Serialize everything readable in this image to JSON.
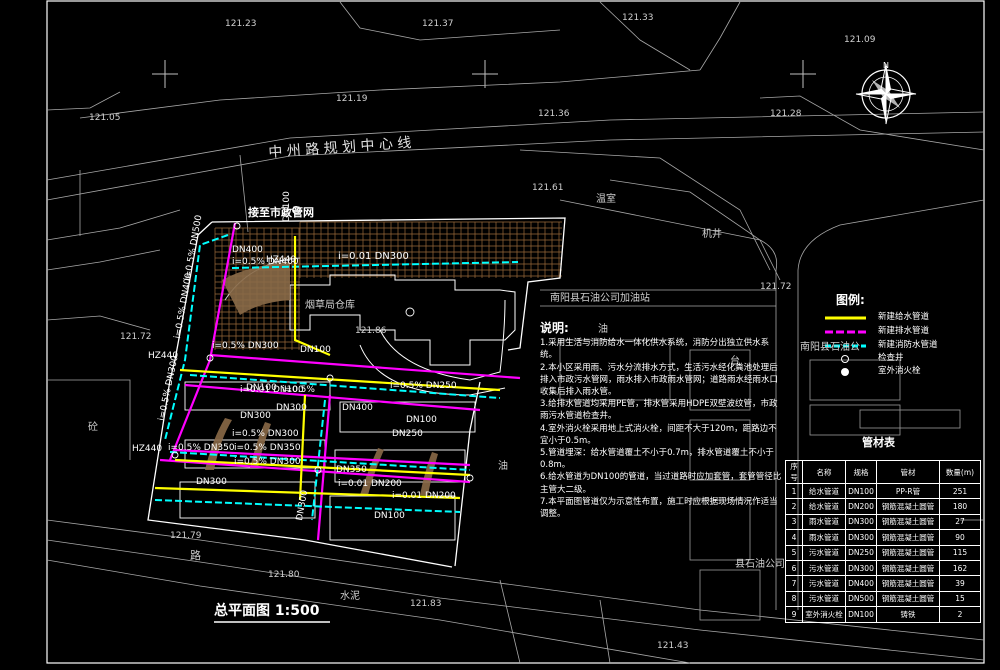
{
  "drawing_title": "总平面图  1:500",
  "road_centerline_label": "中 州 路 规 划 中 心 线",
  "connect_label": "接至市政管网",
  "site_labels": {
    "warehouse": "烟草局仓库",
    "gas_station": "南阳县石油公司加油站",
    "oil_company_right": "南阳县石油公",
    "oil_company_bottom": "县石油公司",
    "well": "机井",
    "road": "路",
    "ditch": "水泥",
    "hill": "砼",
    "oil": "油",
    "shed": "棚",
    "shed2": "温室",
    "gate": "台"
  },
  "elevations": [
    "121.23",
    "121.37",
    "121.33",
    "121.09",
    "121.19",
    "121.36",
    "121.05",
    "121.28",
    "121.61",
    "121.72",
    "121.72",
    "121.80",
    "121.83",
    "121.79",
    "121.43",
    "121.86"
  ],
  "pipes": {
    "main_dn300": "i=0.01 DN300",
    "dn400": "DN400",
    "slope_dn400": "i=0.5% DN400",
    "hz440_1": "HZ440",
    "hz440_2": "HZ440",
    "hz440_3": "HZ440",
    "dn100_v": "DN100",
    "dn500": "i=0.5% DN500",
    "dn300_v": "i=0.5% DN300",
    "dn250": "i=0.5% DN250",
    "dn100_a": "DN100",
    "slope_05": "i=0.5%",
    "dn300_a": "DN300",
    "dn300_b": "DN300",
    "dn400_b": "DN400",
    "dn250_b": "DN250",
    "dn100_b": "i=0.01 DN100",
    "dn300_c": "i=0.5% DN300",
    "dn350": "i=0.5% DN350",
    "dn300_d": "i=0.5% DN300",
    "dn200": "i=0.01 DN200",
    "dn350_b": "i=0.5% DN350",
    "dn200_b": "i=0.01 DN200",
    "dn300_e": "DN300",
    "dn300_f": "DN300",
    "dn100_c": "DN100",
    "dn100_d": "DN100",
    "dn100_e": "DN100",
    "dn400_v": "i=0.5% DN400",
    "dn300_g": "i=0.5% DN300",
    "dn350_c": "DN350"
  },
  "legend": {
    "title": "图例:",
    "items": [
      {
        "label": "新建给水管道",
        "color": "#ffff00"
      },
      {
        "label": "新建排水管道",
        "color": "#ff00ff"
      },
      {
        "label": "新建消防水管道",
        "color": "#00ffff"
      },
      {
        "label": "检查井",
        "color": "#ffffff"
      },
      {
        "label": "室外消火栓",
        "color": "#ffffff"
      }
    ]
  },
  "notes": {
    "title": "说明:",
    "items": [
      "1.采用生活与消防给水一体化供水系统，消防分出独立供水系统。",
      "2.本小区采用雨、污水分流排水方式，生活污水经化粪池处理后排入市政污水管网，雨水排入市政雨水管网；道路雨水经雨水口收集后排入雨水管。",
      "3.给排水管道均采用PE管，排水管采用HDPE双壁波纹管，市政雨污水管道检查井。",
      "4.室外消火栓采用地上式消火栓，间距不大于120m，距路边不宜小于0.5m。",
      "5.管道埋深：给水管道覆土不小于0.7m，排水管道覆土不小于0.8m。",
      "6.给水管道为DN100的管道，当过道路时应加套管，套管管径比主管大二级。",
      "7.本平面图管道仅为示意性布置，施工时应根据现场情况作适当调整。"
    ]
  },
  "materials": {
    "title": "管材表",
    "headers": [
      "序号",
      "名称",
      "规格",
      "管材",
      "数量(m)"
    ],
    "rows": [
      [
        "1",
        "给水管道",
        "DN100",
        "PP-R管",
        "251"
      ],
      [
        "2",
        "给水管道",
        "DN200",
        "钢筋混凝土圆管",
        "180"
      ],
      [
        "3",
        "雨水管道",
        "DN300",
        "钢筋混凝土圆管",
        "27"
      ],
      [
        "4",
        "雨水管道",
        "DN300",
        "钢筋混凝土圆管",
        "90"
      ],
      [
        "5",
        "污水管道",
        "DN250",
        "钢筋混凝土圆管",
        "115"
      ],
      [
        "6",
        "污水管道",
        "DN300",
        "钢筋混凝土圆管",
        "162"
      ],
      [
        "7",
        "污水管道",
        "DN400",
        "钢筋混凝土圆管",
        "39"
      ],
      [
        "8",
        "污水管道",
        "DN500",
        "钢筋混凝土圆管",
        "15"
      ],
      [
        "9",
        "室外消火栓",
        "DN100",
        "铸铁",
        "2"
      ]
    ]
  },
  "colors": {
    "water": "#ffff00",
    "drain": "#ff00ff",
    "fire": "#00ffff",
    "grid": "#9a6a3a",
    "line": "#bfbfbf",
    "frame": "#ffffff"
  }
}
